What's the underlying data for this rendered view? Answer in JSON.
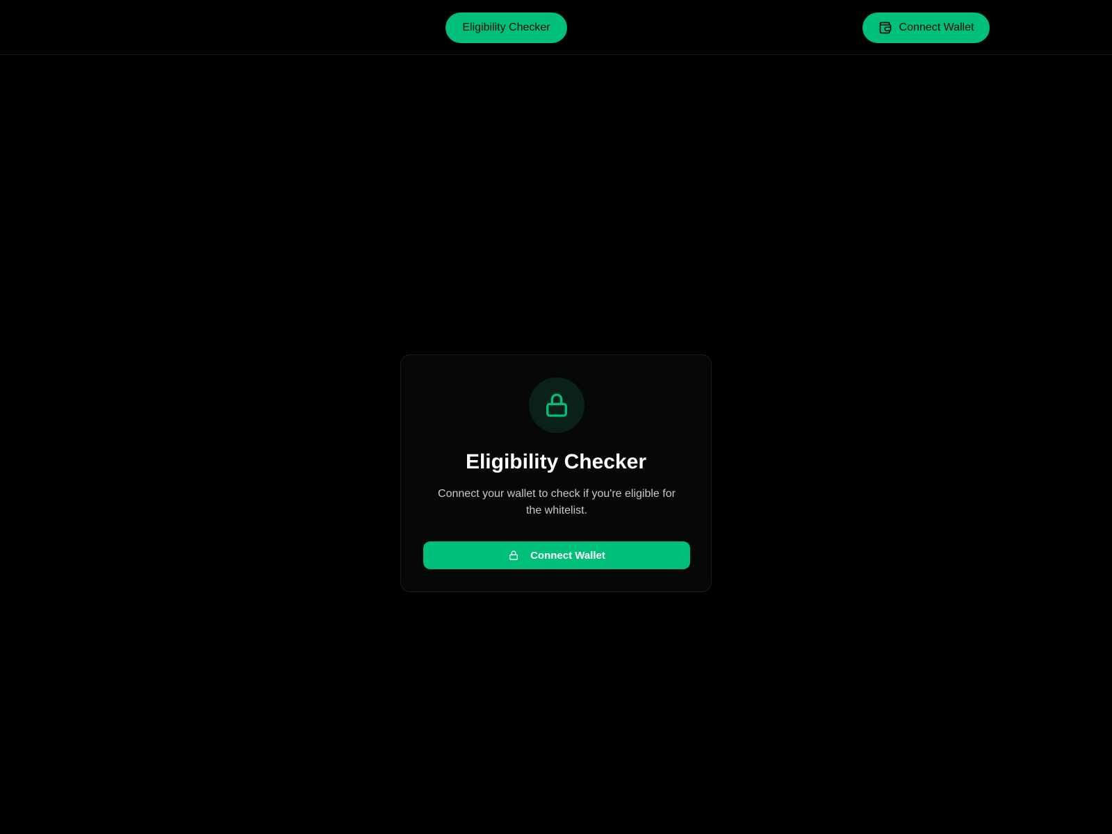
{
  "colors": {
    "background": "#000000",
    "accent": "#00bf7a",
    "card_background": "#060707",
    "card_border": "#1c1f1f",
    "lock_circle": "#0a2119"
  },
  "header": {
    "nav_button_label": "Eligibility Checker",
    "connect_wallet_label": "Connect Wallet",
    "connect_wallet_icon": "wallet-icon"
  },
  "card": {
    "icon": "lock-icon",
    "title": "Eligibility Checker",
    "description": "Connect your wallet to check if you're eligible for the whitelist.",
    "button_label": "Connect Wallet",
    "button_icon": "lock-icon"
  }
}
